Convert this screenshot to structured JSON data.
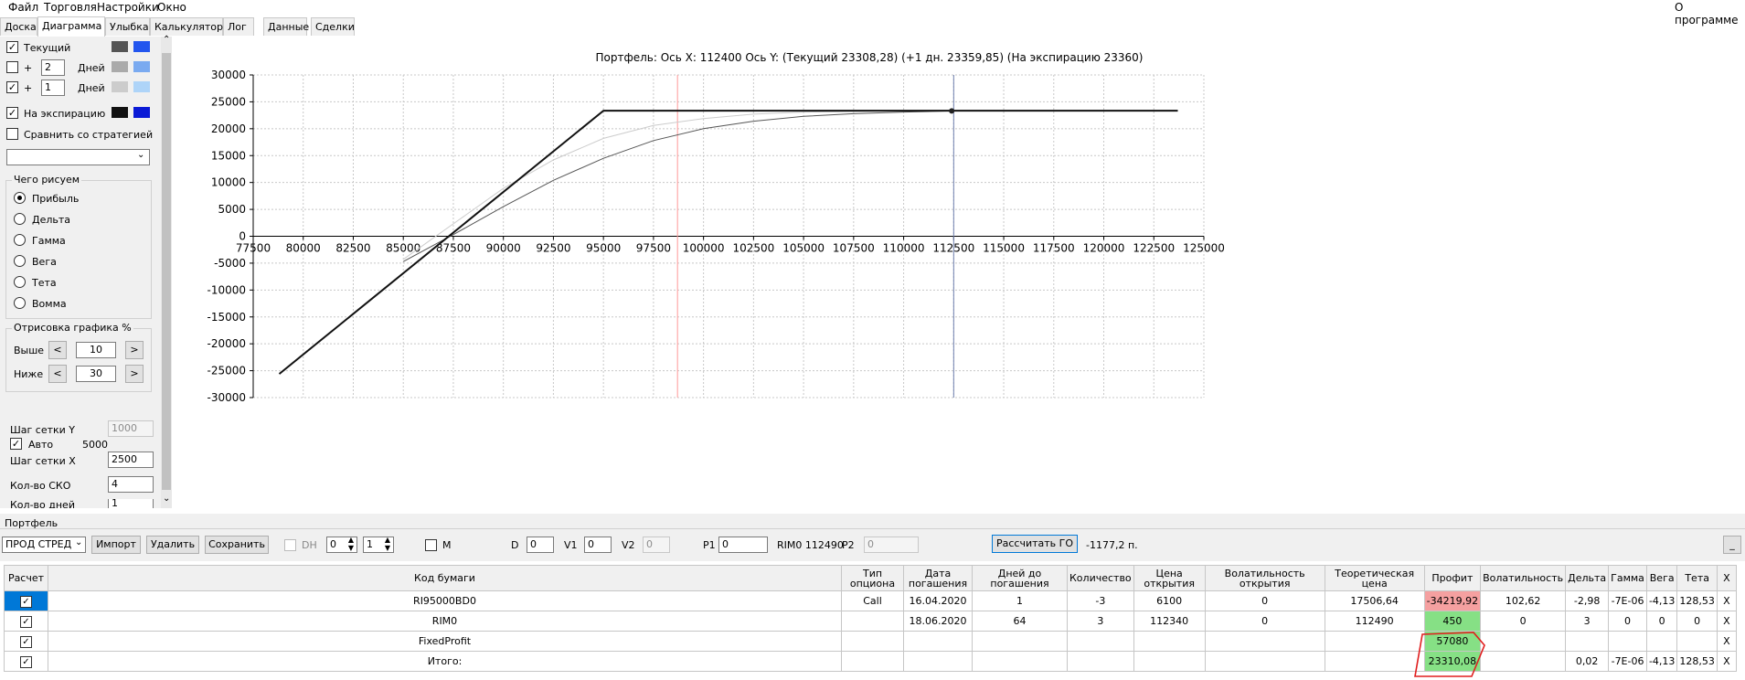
{
  "menu": {
    "file": "Файл",
    "trade": "Торговля",
    "settings": "Настройки",
    "window": "Окно",
    "about": "О программе"
  },
  "tabs": [
    "Доска",
    "Диаграмма",
    "Улыбка",
    "Калькулятор",
    "Лог",
    "Данные",
    "Сделки"
  ],
  "active_tab": "Диаграмма",
  "left": {
    "current_label": "Текущий",
    "plus_sign": "+",
    "days1_value": "2",
    "days_label": "Дней",
    "days2_value": "1",
    "expiration_label": "На экспирацию",
    "compare_label": "Сравнить со стратегией",
    "draw_group_title": "Чего рисуем",
    "radios": [
      "Прибыль",
      "Дельта",
      "Гамма",
      "Вега",
      "Тета",
      "Вомма"
    ],
    "render_group_title": "Отрисовка графика %",
    "above_label": "Выше",
    "above_value": "10",
    "below_label": "Ниже",
    "below_value": "30",
    "prev_symbol": "<",
    "next_symbol": ">",
    "grid_y_label": "Шаг сетки Y",
    "grid_y_value": "1000",
    "auto_label": "Авто",
    "auto_value": "5000",
    "grid_x_label": "Шаг сетки X",
    "grid_x_value": "2500",
    "sko_label": "Кол-во СКО",
    "sko_value": "4",
    "days_count_label": "Кол-во дней",
    "days_count_value": "1",
    "swatch_colors": {
      "current": [
        "#555555",
        "#2255ee"
      ],
      "plus2": [
        "#aaaaaa",
        "#7aaaf0"
      ],
      "plus1": [
        "#cccccc",
        "#aed4f8"
      ],
      "expiration": [
        "#111111",
        "#0a1ad6"
      ]
    }
  },
  "chart_data": {
    "type": "line",
    "title": "Портфель: Ось X:  112400  Ось Y:  (Текущий 23308,28)  (+1 дн. 23359,85)  (На экспирацию 23360)",
    "xlim": [
      77500,
      125000
    ],
    "ylim": [
      -30000,
      30000
    ],
    "x_ticks": [
      77500,
      80000,
      82500,
      85000,
      87500,
      90000,
      92500,
      95000,
      97500,
      100000,
      102500,
      105000,
      107500,
      110000,
      112500,
      115000,
      117500,
      120000,
      122500,
      125000
    ],
    "y_ticks": [
      30000,
      25000,
      20000,
      15000,
      10000,
      5000,
      0,
      -5000,
      -10000,
      -15000,
      -20000,
      -25000,
      -30000
    ],
    "grid": true,
    "vlines": [
      {
        "x": 98700,
        "color": "#ff9999"
      },
      {
        "x": 112500,
        "color": "#7080b0"
      }
    ],
    "marker": {
      "x": 112400,
      "y": 23308
    },
    "series": [
      {
        "color": "#111111",
        "width": 2,
        "points": [
          [
            78800,
            -25600
          ],
          [
            95000,
            23360
          ],
          [
            123700,
            23360
          ]
        ]
      },
      {
        "color": "#cccccc",
        "width": 1,
        "points": [
          [
            85000,
            -4300
          ],
          [
            87000,
            1000
          ],
          [
            90000,
            8900
          ],
          [
            92500,
            14200
          ],
          [
            95000,
            18200
          ],
          [
            97500,
            20600
          ],
          [
            100000,
            21900
          ],
          [
            102500,
            22700
          ],
          [
            105000,
            23100
          ],
          [
            110000,
            23300
          ],
          [
            112400,
            23350
          ]
        ]
      },
      {
        "color": "#555555",
        "width": 1,
        "points": [
          [
            85000,
            -4700
          ],
          [
            87500,
            300
          ],
          [
            90000,
            5500
          ],
          [
            92500,
            10400
          ],
          [
            95000,
            14500
          ],
          [
            97500,
            17800
          ],
          [
            100000,
            20000
          ],
          [
            102500,
            21400
          ],
          [
            105000,
            22300
          ],
          [
            107500,
            22800
          ],
          [
            110000,
            23100
          ],
          [
            112400,
            23300
          ]
        ]
      }
    ]
  },
  "portfolio": {
    "section_label": "Портфель",
    "strategy": "ПРОД СТРЕД",
    "import_btn": "Импорт",
    "delete_btn": "Удалить",
    "save_btn": "Сохранить",
    "dh_label": "DH",
    "spin1": "0",
    "spin2": "1",
    "m_label": "M",
    "d_label": "D",
    "d_value": "0",
    "v1_label": "V1",
    "v1_value": "0",
    "v2_label": "V2",
    "v2_value": "0",
    "p1_label": "P1",
    "p1_value": "0",
    "rim_label": "RIM0 112490",
    "p2_label": "P2",
    "p2_value": "0",
    "calc_btn": "Рассчитать ГО",
    "go_value": "-1177,2 п.",
    "min_btn": "_"
  },
  "table": {
    "headers": [
      "Расчет",
      "Код бумаги",
      "Тип опциона",
      "Дата погашения",
      "Дней до погашения",
      "Количество",
      "Цена открытия",
      "Волатильность открытия",
      "Теоретическая цена",
      "Профит",
      "Волатильность",
      "Дельта",
      "Гамма",
      "Вега",
      "Тета",
      "X"
    ],
    "rows": [
      [
        "RI95000BD0",
        "Call",
        "16.04.2020",
        "1",
        "-3",
        "6100",
        "0",
        "17506,64",
        "-34219,92",
        "102,62",
        "-2,98",
        "-7E-06",
        "-4,13",
        "128,53",
        "X"
      ],
      [
        "RIM0",
        "",
        "18.06.2020",
        "64",
        "3",
        "112340",
        "0",
        "112490",
        "450",
        "0",
        "3",
        "0",
        "0",
        "0",
        "X"
      ],
      [
        "FixedProfit",
        "",
        "",
        "",
        "",
        "",
        "",
        "",
        "57080",
        "",
        "",
        "",
        "",
        "",
        "X"
      ],
      [
        "Итого:",
        "",
        "",
        "",
        "",
        "",
        "",
        "",
        "23310,08",
        "",
        "0,02",
        "-7E-06",
        "-4,13",
        "128,53",
        "X"
      ]
    ]
  }
}
